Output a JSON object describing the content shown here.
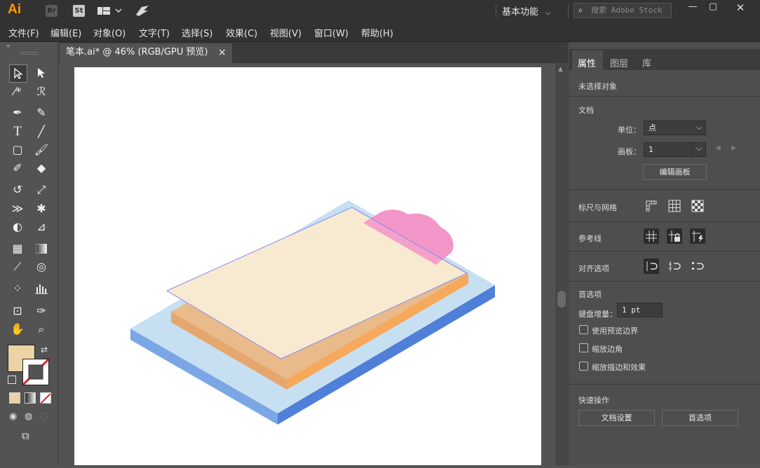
{
  "app": {
    "logo": "Ai",
    "bridge_icon": "Br",
    "stock_icon": "St",
    "workspace": "基本功能",
    "search_placeholder": "搜索 Adobe Stock"
  },
  "menu": [
    "文件(F)",
    "编辑(E)",
    "对象(O)",
    "文字(T)",
    "选择(S)",
    "效果(C)",
    "视图(V)",
    "窗口(W)",
    "帮助(H)"
  ],
  "document": {
    "tab_label": "笔本.ai* @ 46% (RGB/GPU 预览)",
    "close_glyph": "×"
  },
  "colors": {
    "fill": "#ecd3a5",
    "accent_pink": "#f296c8",
    "paper": "#f8ead0",
    "board_top": "#c6e0f2",
    "board_side": "#4f7fd9",
    "pad_tan": "#e9bb8a",
    "pad_orange": "#f7a85b"
  },
  "panel": {
    "tabs": [
      "属性",
      "图层",
      "库"
    ],
    "no_selection": "未选择对象",
    "doc_section": "文档",
    "unit_label": "单位：",
    "unit_value": "点",
    "artboard_label": "画板：",
    "artboard_value": "1",
    "edit_artboards_btn": "编辑画板",
    "rulers_grids": "标尺与网格",
    "guides": "参考线",
    "align_options": "对齐选项",
    "prefs_section": "首选项",
    "keyboard_increment_label": "键盘增量：",
    "keyboard_increment_value": "1 pt",
    "check_preview_bounds": "使用预览边界",
    "check_scale_corners": "缩放边角",
    "check_scale_strokes": "缩放描边和效果",
    "quick_actions": "快速操作",
    "doc_setup_btn": "文档设置",
    "prefs_btn": "首选项"
  }
}
